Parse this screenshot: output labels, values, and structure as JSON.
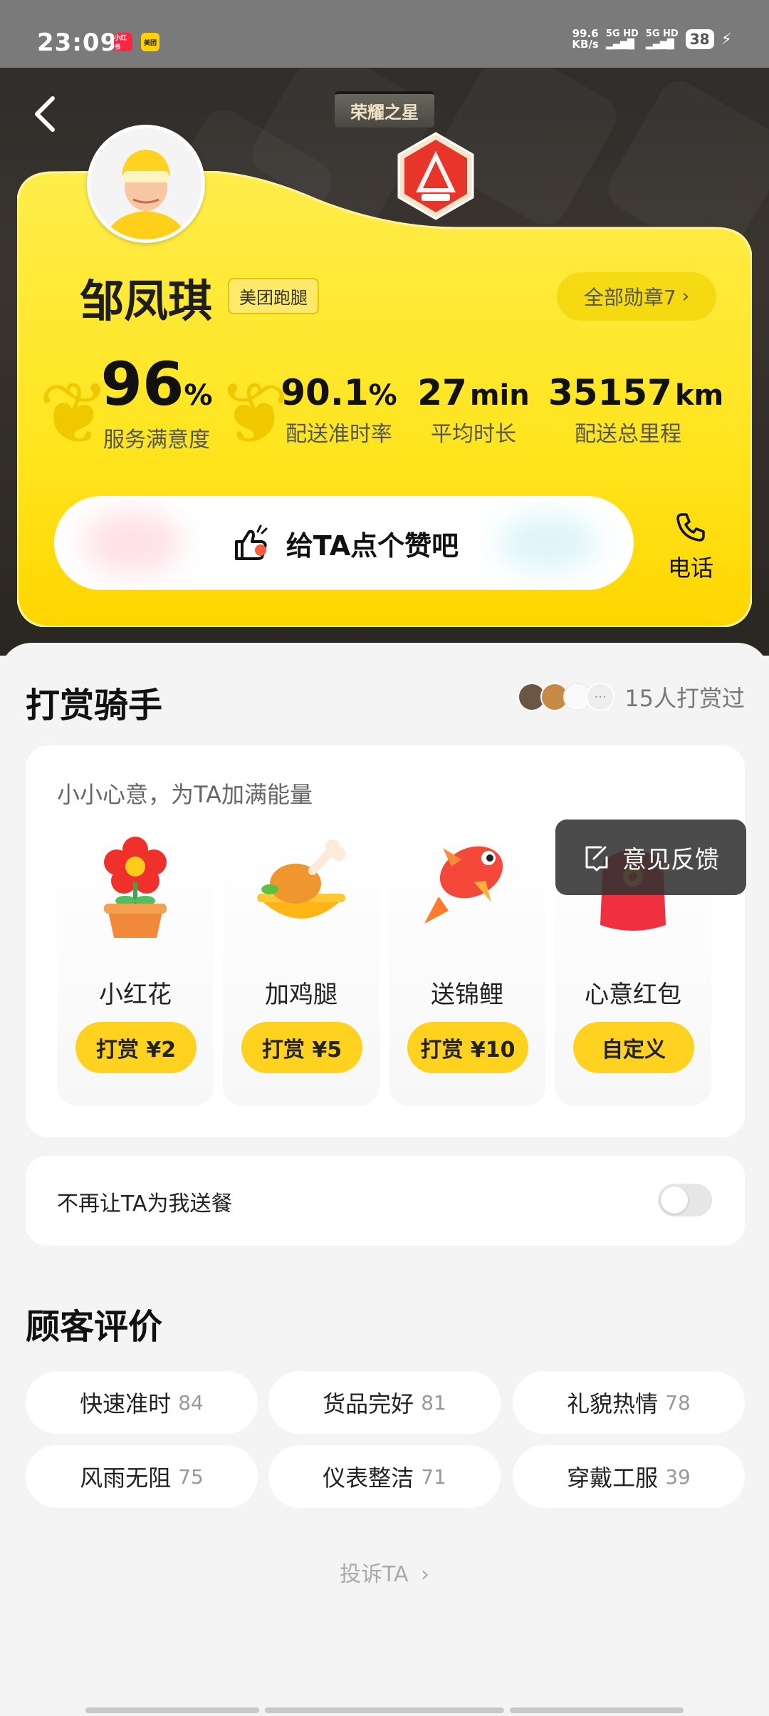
{
  "status_bar": {
    "time": "23:09",
    "app_icons": [
      {
        "name": "xiaohongshu-icon",
        "text": "小红书",
        "color": "#ff2442"
      },
      {
        "name": "meituan-icon",
        "text": "美团",
        "color": "#ffd100"
      }
    ],
    "net_speed_value": "99.6",
    "net_speed_unit": "KB/s",
    "sim1": "5G HD",
    "sim2": "5G HD",
    "battery": "38"
  },
  "header": {
    "medal_title": "荣耀之星"
  },
  "rider": {
    "name": "邹凤琪",
    "tag": "美团跑腿",
    "badges_link": "全部勋章7"
  },
  "stats": [
    {
      "value": "96",
      "unit": "%",
      "label": "服务满意度"
    },
    {
      "value": "90.1",
      "unit": "%",
      "label": "配送准时率"
    },
    {
      "value": "27",
      "unit": "min",
      "label": "平均时长"
    },
    {
      "value": "35157",
      "unit": "km",
      "label": "配送总里程"
    }
  ],
  "actions": {
    "thumbs_up": "给TA点个赞吧",
    "phone": "电话"
  },
  "reward": {
    "title": "打赏骑手",
    "tippers_count": "15人打赏过",
    "subtitle": "小小心意，为TA加满能量",
    "gifts": [
      {
        "name": "小红花",
        "button": "打赏 ¥2"
      },
      {
        "name": "加鸡腿",
        "button": "打赏 ¥5"
      },
      {
        "name": "送锦鲤",
        "button": "打赏 ¥10"
      },
      {
        "name": "心意红包",
        "button": "自定义"
      }
    ]
  },
  "feedback": "意见反馈",
  "block": {
    "label": "不再让TA为我送餐",
    "enabled": false
  },
  "reviews": {
    "title": "顾客评价",
    "tags": [
      {
        "label": "快速准时",
        "count": "84"
      },
      {
        "label": "货品完好",
        "count": "81"
      },
      {
        "label": "礼貌热情",
        "count": "78"
      },
      {
        "label": "风雨无阻",
        "count": "75"
      },
      {
        "label": "仪表整洁",
        "count": "71"
      },
      {
        "label": "穿戴工服",
        "count": "39"
      }
    ]
  },
  "complain": "投诉TA"
}
